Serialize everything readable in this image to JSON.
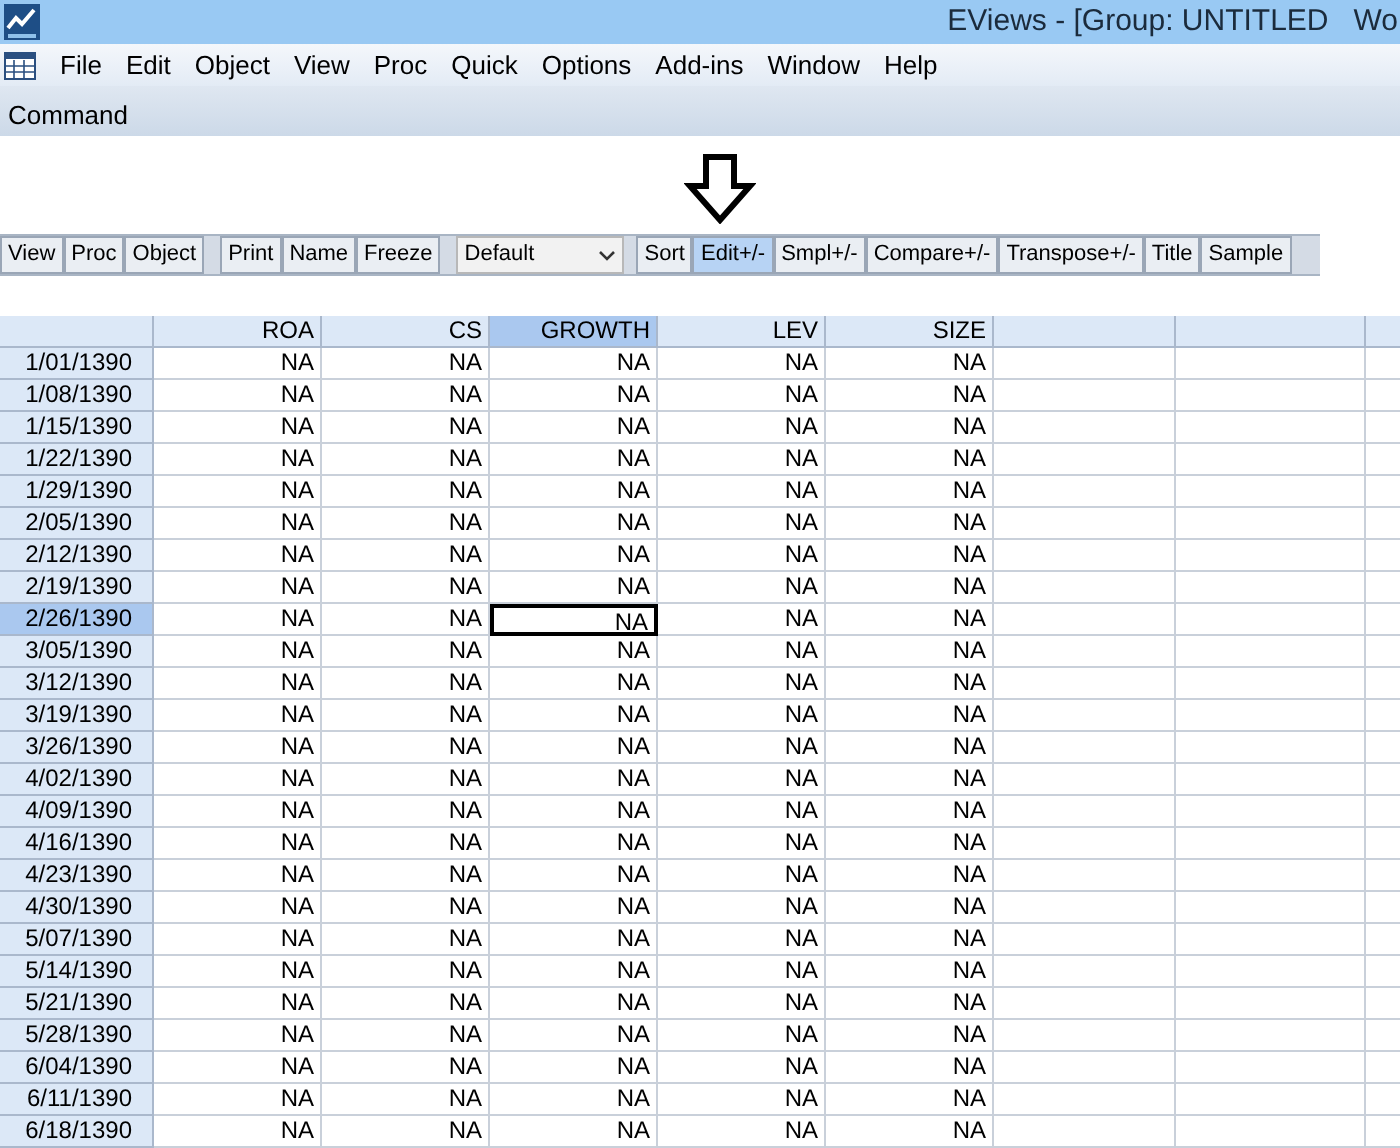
{
  "window": {
    "title": "EViews - [Group: UNTITLED   Wo"
  },
  "menu": [
    "File",
    "Edit",
    "Object",
    "View",
    "Proc",
    "Quick",
    "Options",
    "Add-ins",
    "Window",
    "Help"
  ],
  "command_bar": {
    "label": "Command"
  },
  "toolbar": [
    {
      "kind": "buttons",
      "buttons": [
        {
          "label": "View",
          "selected": false
        },
        {
          "label": "Proc",
          "selected": false
        },
        {
          "label": "Object",
          "selected": false
        }
      ]
    },
    {
      "kind": "buttons",
      "buttons": [
        {
          "label": "Print",
          "selected": false
        },
        {
          "label": "Name",
          "selected": false
        },
        {
          "label": "Freeze",
          "selected": false
        }
      ]
    },
    {
      "kind": "dropdown",
      "value": "Default"
    },
    {
      "kind": "buttons",
      "buttons": [
        {
          "label": "Sort",
          "selected": false
        },
        {
          "label": "Edit+/-",
          "selected": true
        },
        {
          "label": "Smpl+/-",
          "selected": false
        },
        {
          "label": "Compare+/-",
          "selected": false
        },
        {
          "label": "Transpose+/-",
          "selected": false
        },
        {
          "label": "Title",
          "selected": false
        },
        {
          "label": "Sample",
          "selected": false
        }
      ]
    }
  ],
  "table": {
    "columns": [
      {
        "label": "ROA",
        "selected": false
      },
      {
        "label": "CS",
        "selected": false
      },
      {
        "label": "GROWTH",
        "selected": true
      },
      {
        "label": "LEV",
        "selected": false
      },
      {
        "label": "SIZE",
        "selected": false
      }
    ],
    "rows": [
      {
        "date": "1/01/1390",
        "values": [
          "NA",
          "NA",
          "NA",
          "NA",
          "NA"
        ],
        "selected": false
      },
      {
        "date": "1/08/1390",
        "values": [
          "NA",
          "NA",
          "NA",
          "NA",
          "NA"
        ],
        "selected": false
      },
      {
        "date": "1/15/1390",
        "values": [
          "NA",
          "NA",
          "NA",
          "NA",
          "NA"
        ],
        "selected": false
      },
      {
        "date": "1/22/1390",
        "values": [
          "NA",
          "NA",
          "NA",
          "NA",
          "NA"
        ],
        "selected": false
      },
      {
        "date": "1/29/1390",
        "values": [
          "NA",
          "NA",
          "NA",
          "NA",
          "NA"
        ],
        "selected": false
      },
      {
        "date": "2/05/1390",
        "values": [
          "NA",
          "NA",
          "NA",
          "NA",
          "NA"
        ],
        "selected": false
      },
      {
        "date": "2/12/1390",
        "values": [
          "NA",
          "NA",
          "NA",
          "NA",
          "NA"
        ],
        "selected": false
      },
      {
        "date": "2/19/1390",
        "values": [
          "NA",
          "NA",
          "NA",
          "NA",
          "NA"
        ],
        "selected": false
      },
      {
        "date": "2/26/1390",
        "values": [
          "NA",
          "NA",
          "NA",
          "NA",
          "NA"
        ],
        "selected": true
      },
      {
        "date": "3/05/1390",
        "values": [
          "NA",
          "NA",
          "NA",
          "NA",
          "NA"
        ],
        "selected": false
      },
      {
        "date": "3/12/1390",
        "values": [
          "NA",
          "NA",
          "NA",
          "NA",
          "NA"
        ],
        "selected": false
      },
      {
        "date": "3/19/1390",
        "values": [
          "NA",
          "NA",
          "NA",
          "NA",
          "NA"
        ],
        "selected": false
      },
      {
        "date": "3/26/1390",
        "values": [
          "NA",
          "NA",
          "NA",
          "NA",
          "NA"
        ],
        "selected": false
      },
      {
        "date": "4/02/1390",
        "values": [
          "NA",
          "NA",
          "NA",
          "NA",
          "NA"
        ],
        "selected": false
      },
      {
        "date": "4/09/1390",
        "values": [
          "NA",
          "NA",
          "NA",
          "NA",
          "NA"
        ],
        "selected": false
      },
      {
        "date": "4/16/1390",
        "values": [
          "NA",
          "NA",
          "NA",
          "NA",
          "NA"
        ],
        "selected": false
      },
      {
        "date": "4/23/1390",
        "values": [
          "NA",
          "NA",
          "NA",
          "NA",
          "NA"
        ],
        "selected": false
      },
      {
        "date": "4/30/1390",
        "values": [
          "NA",
          "NA",
          "NA",
          "NA",
          "NA"
        ],
        "selected": false
      },
      {
        "date": "5/07/1390",
        "values": [
          "NA",
          "NA",
          "NA",
          "NA",
          "NA"
        ],
        "selected": false
      },
      {
        "date": "5/14/1390",
        "values": [
          "NA",
          "NA",
          "NA",
          "NA",
          "NA"
        ],
        "selected": false
      },
      {
        "date": "5/21/1390",
        "values": [
          "NA",
          "NA",
          "NA",
          "NA",
          "NA"
        ],
        "selected": false
      },
      {
        "date": "5/28/1390",
        "values": [
          "NA",
          "NA",
          "NA",
          "NA",
          "NA"
        ],
        "selected": false
      },
      {
        "date": "6/04/1390",
        "values": [
          "NA",
          "NA",
          "NA",
          "NA",
          "NA"
        ],
        "selected": false
      },
      {
        "date": "6/11/1390",
        "values": [
          "NA",
          "NA",
          "NA",
          "NA",
          "NA"
        ],
        "selected": false
      },
      {
        "date": "6/18/1390",
        "values": [
          "NA",
          "NA",
          "NA",
          "NA",
          "NA"
        ],
        "selected": false
      }
    ]
  }
}
